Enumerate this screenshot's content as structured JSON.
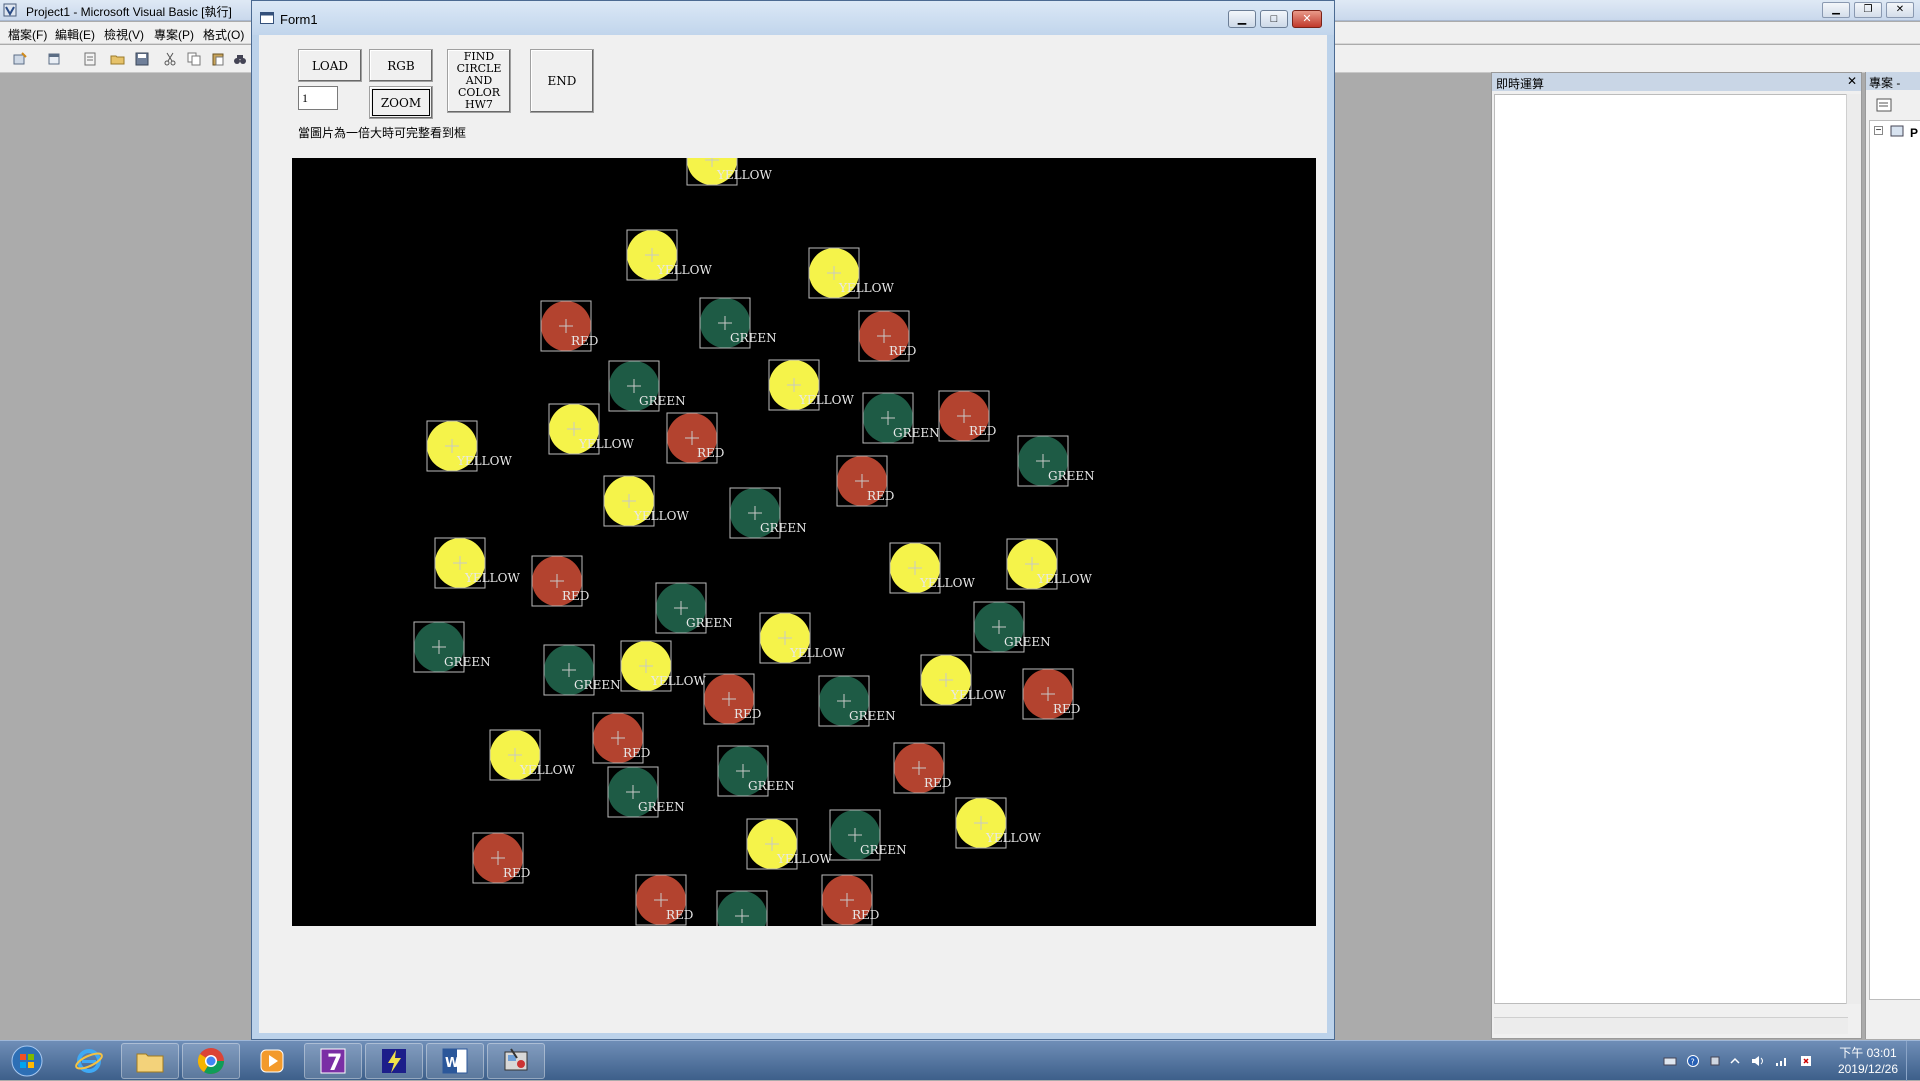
{
  "ide": {
    "title": "Project1 - Microsoft Visual Basic [執行]",
    "menu": [
      "檔案(F)",
      "編輯(E)",
      "檢視(V)",
      "專案(P)",
      "格式(O)"
    ]
  },
  "form": {
    "title": "Form1",
    "buttons": {
      "load": "LOAD",
      "rgb": "RGB",
      "find": "FIND\nCIRCLE\nAND\nCOLOR\nHW7",
      "end": "END",
      "zoom": "ZOOM"
    },
    "zoom_value": "1",
    "hint": "當圖片為一倍大時可完整看到框",
    "circle_colors": {
      "RED": "#b3432f",
      "GREEN": "#1e5b45",
      "YELLOW": "#f5f34a"
    },
    "circles": [
      {
        "label": "YELLOW"
      },
      {
        "label": "YELLOW"
      },
      {
        "label": "YELLOW"
      },
      {
        "label": "RED"
      },
      {
        "label": "GREEN"
      },
      {
        "label": "RED"
      },
      {
        "label": "GREEN"
      },
      {
        "label": "YELLOW"
      },
      {
        "label": "GREEN"
      },
      {
        "label": "YELLOW"
      },
      {
        "label": "RED"
      },
      {
        "label": "YELLOW"
      },
      {
        "label": "RED"
      },
      {
        "label": "GREEN"
      },
      {
        "label": "RED"
      },
      {
        "label": "YELLOW"
      },
      {
        "label": "GREEN"
      },
      {
        "label": "YELLOW"
      },
      {
        "label": "YELLOW"
      },
      {
        "label": "YELLOW"
      },
      {
        "label": "RED"
      },
      {
        "label": "GREEN"
      },
      {
        "label": "YELLOW"
      },
      {
        "label": "GREEN"
      },
      {
        "label": "GREEN"
      },
      {
        "label": "GREEN"
      },
      {
        "label": "YELLOW"
      },
      {
        "label": "RED"
      },
      {
        "label": "GREEN"
      },
      {
        "label": "YELLOW"
      },
      {
        "label": "RED"
      },
      {
        "label": "RED"
      },
      {
        "label": "YELLOW"
      },
      {
        "label": "GREEN"
      },
      {
        "label": "RED"
      },
      {
        "label": "GREEN"
      },
      {
        "label": "YELLOW"
      },
      {
        "label": "GREEN"
      },
      {
        "label": "YELLOW"
      },
      {
        "label": "RED"
      },
      {
        "label": "RED"
      },
      {
        "label": "RED"
      },
      {
        "label": "GREEN"
      }
    ]
  },
  "panes": {
    "immediate_title": "即時運算",
    "project_title": "專案 -",
    "project_root": "P"
  },
  "taskbar": {
    "time": "下午 03:01",
    "date": "2019/12/26"
  }
}
